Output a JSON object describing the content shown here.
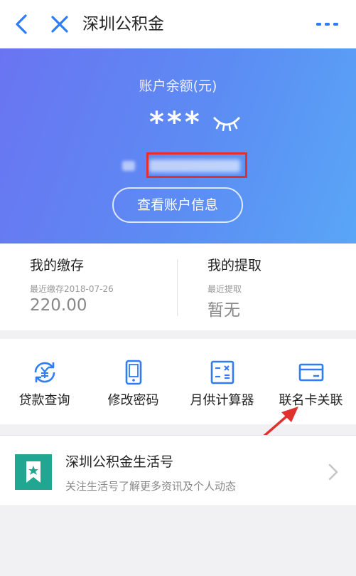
{
  "header": {
    "title": "深圳公积金",
    "back_icon": "chevron-left-icon",
    "close_icon": "close-icon",
    "more_icon": "more-horizontal-icon",
    "accent": "#2e7cf6"
  },
  "balance": {
    "label": "账户余额(元)",
    "masked_value": "***",
    "eye_icon": "eye-closed-icon",
    "account_info_button": "查看账户信息",
    "gradient": [
      "#6a74f2",
      "#59a6f7"
    ],
    "highlight_color": "#e0312f"
  },
  "stats": {
    "deposit": {
      "title": "我的缴存",
      "sub": "最近缴存2018-07-26",
      "value": "220.00"
    },
    "withdraw": {
      "title": "我的提取",
      "sub": "最近提取",
      "value": "暂无"
    }
  },
  "actions": [
    {
      "label": "贷款查询",
      "icon": "yen-refresh-icon"
    },
    {
      "label": "修改密码",
      "icon": "phone-icon"
    },
    {
      "label": "月供计算器",
      "icon": "calculator-icon"
    },
    {
      "label": "联名卡关联",
      "icon": "bank-card-icon"
    }
  ],
  "service_card": {
    "title": "深圳公积金生活号",
    "description": "关注生活号了解更多资讯及个人动态",
    "logo_icon": "bookmark-star-icon",
    "logo_color": "#21a791"
  }
}
